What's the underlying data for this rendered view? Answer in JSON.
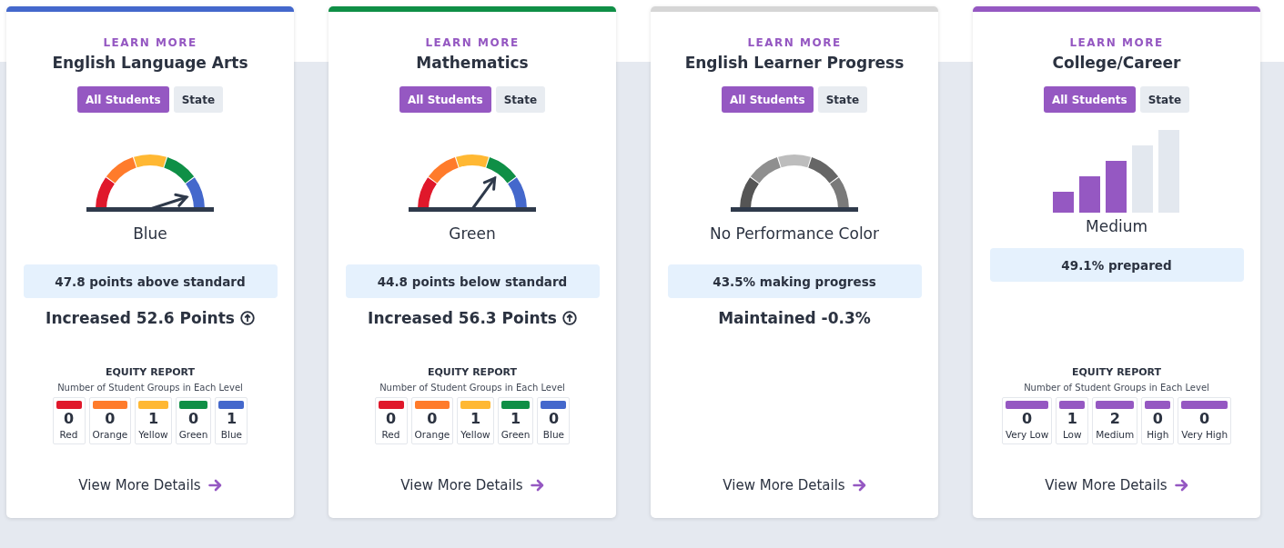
{
  "cards": [
    {
      "color": "#4468cc",
      "learn_more": "LEARN MORE",
      "title": "English Language Arts",
      "toggles": [
        {
          "label": "All Students",
          "selected": true
        },
        {
          "label": "State",
          "selected": false
        }
      ],
      "indicator": {
        "kind": "gauge",
        "colored": true,
        "label": "Blue"
      },
      "summary": "47.8 points above standard",
      "change": {
        "text": "Increased 52.6 Points",
        "increase": true
      },
      "equity": {
        "title": "EQUITY REPORT",
        "subtitle": "Number of Student Groups in Each Level",
        "levels": [
          {
            "color": "#e0182b",
            "count": "0",
            "label": "Red"
          },
          {
            "color": "#ff7b2b",
            "count": "0",
            "label": "Orange"
          },
          {
            "color": "#ffb833",
            "count": "1",
            "label": "Yellow"
          },
          {
            "color": "#0f8f46",
            "count": "0",
            "label": "Green"
          },
          {
            "color": "#4468cc",
            "count": "1",
            "label": "Blue"
          }
        ]
      },
      "link": "View More Details"
    },
    {
      "color": "#0f8f46",
      "learn_more": "LEARN MORE",
      "title": "Mathematics",
      "toggles": [
        {
          "label": "All Students",
          "selected": true
        },
        {
          "label": "State",
          "selected": false
        }
      ],
      "indicator": {
        "kind": "gauge",
        "colored": true,
        "label": "Green"
      },
      "summary": "44.8 points below standard",
      "change": {
        "text": "Increased 56.3 Points",
        "increase": true
      },
      "equity": {
        "title": "EQUITY REPORT",
        "subtitle": "Number of Student Groups in Each Level",
        "levels": [
          {
            "color": "#e0182b",
            "count": "0",
            "label": "Red"
          },
          {
            "color": "#ff7b2b",
            "count": "0",
            "label": "Orange"
          },
          {
            "color": "#ffb833",
            "count": "1",
            "label": "Yellow"
          },
          {
            "color": "#0f8f46",
            "count": "1",
            "label": "Green"
          },
          {
            "color": "#4468cc",
            "count": "0",
            "label": "Blue"
          }
        ]
      },
      "link": "View More Details"
    },
    {
      "color": "#d6d6d6",
      "learn_more": "LEARN MORE",
      "title": "English Learner Progress",
      "toggles": [
        {
          "label": "All Students",
          "selected": true
        },
        {
          "label": "State",
          "selected": false
        }
      ],
      "indicator": {
        "kind": "gauge",
        "colored": false,
        "label": "No Performance Color"
      },
      "summary": "43.5% making progress",
      "change": {
        "text": "Maintained -0.3%",
        "increase": false
      },
      "link": "View More Details"
    },
    {
      "color": "#9558c2",
      "learn_more": "LEARN MORE",
      "title": "College/Career",
      "toggles": [
        {
          "label": "All Students",
          "selected": true
        },
        {
          "label": "State",
          "selected": false
        }
      ],
      "indicator": {
        "kind": "bars",
        "level": 0.6,
        "label": "Medium"
      },
      "summary": "49.1% prepared",
      "equity": {
        "title": "EQUITY REPORT",
        "subtitle": "Number of Student Groups in Each Level",
        "levels": [
          {
            "color": "#9558c2",
            "count": "0",
            "label": "Very Low"
          },
          {
            "color": "#9558c2",
            "count": "1",
            "label": "Low"
          },
          {
            "color": "#9558c2",
            "count": "2",
            "label": "Medium"
          },
          {
            "color": "#9558c2",
            "count": "0",
            "label": "High"
          },
          {
            "color": "#9558c2",
            "count": "0",
            "label": "Very High"
          }
        ]
      },
      "link": "View More Details"
    }
  ]
}
